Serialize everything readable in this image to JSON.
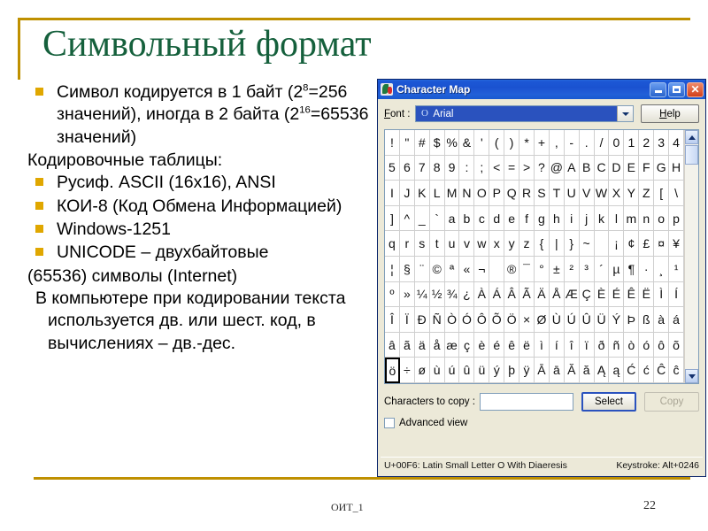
{
  "slide": {
    "title": "Символьный формат",
    "body": {
      "bullets": [
        {
          "id": "b1",
          "lines": [
            "Символ кодируется в 1 байт",
            "(2⁸=256 значений), иногда в 2",
            "байта (2¹⁶=65536 значений)"
          ],
          "text_plain": "Символ кодируется в 1 байт (2^8=256 значений), иногда в 2 байта (2^16=65536 значений)",
          "segments": [
            {
              "t": "Символ кодируется в 1 байт ("
            },
            {
              "t": "2",
              "sup": false
            },
            {
              "t": "8",
              "sup": true
            },
            {
              "t": "=256 значений), иногда в 2 байта ("
            },
            {
              "t": "2",
              "sup": false
            },
            {
              "t": "16",
              "sup": true
            },
            {
              "t": "=65536 значений)"
            }
          ]
        },
        {
          "id": "b2",
          "text_plain": "Русиф. ASCII (16x16), ANSI"
        },
        {
          "id": "b3",
          "text_plain": "КОИ-8 (Код Обмена Информацией)"
        },
        {
          "id": "b4",
          "text_plain": "Windows-1251"
        },
        {
          "id": "b5",
          "text_plain": "UNICODE – двухбайтовые"
        }
      ],
      "plain_line_1": "Кодировочные таблицы:",
      "plain_line_2": " (65536) символы (Internet)",
      "paragraph": "В компьютере при кодировании текста используется дв. или шест. код, в вычислениях – дв.-дес."
    },
    "footer": {
      "label": "ОИТ_1",
      "page_number": "22"
    },
    "colors": {
      "title": "#15603c",
      "frame": "#bf9000",
      "bullet": "#e0a700"
    }
  },
  "charmap": {
    "window_title": "Character Map",
    "titlebar_buttons": {
      "minimize": "_",
      "maximize": "□",
      "close": "✕"
    },
    "font": {
      "label": "Font :",
      "label_prefix": "F",
      "label_rest": "ont :",
      "selected": "Arial",
      "ttf_mark": "O"
    },
    "help_button": {
      "label": "Help",
      "label_prefix": "H",
      "label_rest": "elp"
    },
    "grid": {
      "columns": 20,
      "rows": [
        [
          "!",
          "\"",
          "#",
          "$",
          "%",
          "&",
          "'",
          "(",
          ")",
          "*",
          "+",
          ",",
          "-",
          ".",
          "/",
          "0",
          "1",
          "2",
          "3",
          "4"
        ],
        [
          "5",
          "6",
          "7",
          "8",
          "9",
          ":",
          ";",
          "<",
          "=",
          ">",
          "?",
          "@",
          "A",
          "B",
          "C",
          "D",
          "E",
          "F",
          "G",
          "H"
        ],
        [
          "I",
          "J",
          "K",
          "L",
          "M",
          "N",
          "O",
          "P",
          "Q",
          "R",
          "S",
          "T",
          "U",
          "V",
          "W",
          "X",
          "Y",
          "Z",
          "[",
          "\\"
        ],
        [
          "]",
          "^",
          "_",
          "`",
          "a",
          "b",
          "c",
          "d",
          "e",
          "f",
          "g",
          "h",
          "i",
          "j",
          "k",
          "l",
          "m",
          "n",
          "o",
          "p"
        ],
        [
          "q",
          "r",
          "s",
          "t",
          "u",
          "v",
          "w",
          "x",
          "y",
          "z",
          "{",
          "|",
          "}",
          "~",
          " ",
          "¡",
          "¢",
          "£",
          "¤",
          "¥"
        ],
        [
          "¦",
          "§",
          "¨",
          "©",
          "ª",
          "«",
          "¬",
          "­",
          "®",
          "¯",
          "°",
          "±",
          "²",
          "³",
          "´",
          "µ",
          "¶",
          "·",
          "¸",
          "¹"
        ],
        [
          "º",
          "»",
          "¼",
          "½",
          "¾",
          "¿",
          "À",
          "Á",
          "Â",
          "Ã",
          "Ä",
          "Å",
          "Æ",
          "Ç",
          "È",
          "É",
          "Ê",
          "Ë",
          "Ì",
          "Í"
        ],
        [
          "Î",
          "Ï",
          "Ð",
          "Ñ",
          "Ò",
          "Ó",
          "Ô",
          "Õ",
          "Ö",
          "×",
          "Ø",
          "Ù",
          "Ú",
          "Û",
          "Ü",
          "Ý",
          "Þ",
          "ß",
          "à",
          "á"
        ],
        [
          "â",
          "ã",
          "ä",
          "å",
          "æ",
          "ç",
          "è",
          "é",
          "ê",
          "ë",
          "ì",
          "í",
          "î",
          "ï",
          "ð",
          "ñ",
          "ò",
          "ó",
          "ô",
          "õ"
        ],
        [
          "ö",
          "÷",
          "ø",
          "ù",
          "ú",
          "û",
          "ü",
          "ý",
          "þ",
          "ÿ",
          "Ā",
          "ā",
          "Ă",
          "ă",
          "Ą",
          "ą",
          "Ć",
          "ć",
          "Ĉ",
          "ĉ"
        ]
      ],
      "selected_char": "ö",
      "selected_row": 9,
      "selected_col": 0
    },
    "copy_row": {
      "label": "Characters to copy :",
      "input_value": "",
      "select_button": "Select",
      "copy_button": "Copy"
    },
    "advanced_view": {
      "label": "Advanced view",
      "checked": false
    },
    "status_bar": {
      "left": "U+00F6: Latin Small Letter O With Diaeresis",
      "right": "Keystroke: Alt+0246"
    }
  }
}
